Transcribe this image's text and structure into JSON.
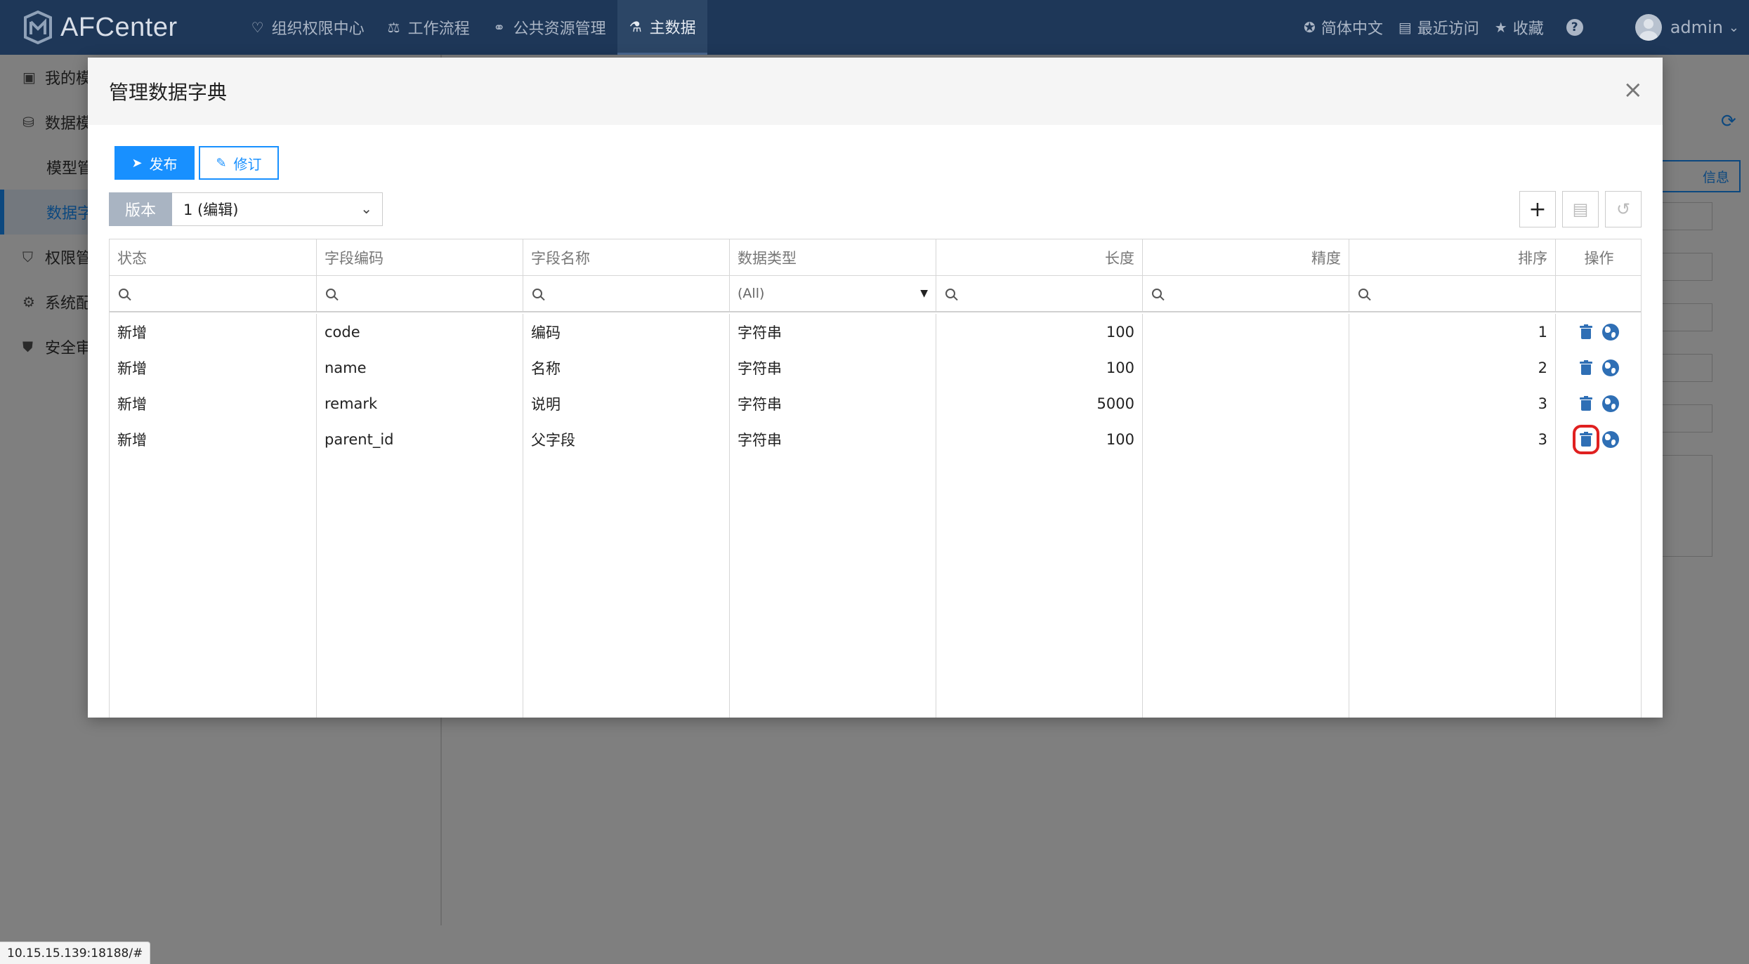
{
  "app": {
    "logo_text": "AFCenter",
    "nav": [
      {
        "label": "组织权限中心",
        "icon": "shield-heart-icon"
      },
      {
        "label": "工作流程",
        "icon": "scale-icon"
      },
      {
        "label": "公共资源管理",
        "icon": "resources-icon"
      },
      {
        "label": "主数据",
        "icon": "master-data-icon",
        "active": true
      }
    ],
    "language": "简体中文",
    "recent": "最近访问",
    "favorites": "收藏",
    "help": "?",
    "user": "admin"
  },
  "sidebar": {
    "items": [
      {
        "label": "我的模",
        "icon": "calendar-icon"
      },
      {
        "label": "数据模",
        "icon": "database-icon"
      },
      {
        "label": "权限管",
        "icon": "permission-shield-icon"
      },
      {
        "label": "系统配",
        "icon": "settings-gear-icon"
      },
      {
        "label": "安全审",
        "icon": "security-audit-icon"
      }
    ],
    "subitems": [
      {
        "label": "模型管"
      },
      {
        "label": "数据字",
        "active": true
      }
    ]
  },
  "background": {
    "button_label": "信息"
  },
  "modal": {
    "title": "管理数据字典",
    "close": "×",
    "publish_label": "发布",
    "revise_label": "修订",
    "version_label": "版本",
    "version_value": "1 (编辑)",
    "add_symbol": "+",
    "columns": [
      "状态",
      "字段编码",
      "字段名称",
      "数据类型",
      "长度",
      "精度",
      "排序",
      "操作"
    ],
    "datatype_filter": "(All)",
    "rows": [
      {
        "status": "新增",
        "code": "code",
        "name": "编码",
        "type": "字符串",
        "length": "100",
        "precision": "",
        "order": "1"
      },
      {
        "status": "新增",
        "code": "name",
        "name": "名称",
        "type": "字符串",
        "length": "100",
        "precision": "",
        "order": "2"
      },
      {
        "status": "新增",
        "code": "remark",
        "name": "说明",
        "type": "字符串",
        "length": "5000",
        "precision": "",
        "order": "3"
      },
      {
        "status": "新增",
        "code": "parent_id",
        "name": "父字段",
        "type": "字符串",
        "length": "100",
        "precision": "",
        "order": "3",
        "highlight": true
      }
    ]
  },
  "statusbar": {
    "url": "10.15.15.139:18188/#"
  },
  "colors": {
    "topnav": "#1e3758",
    "primary": "#1890ff",
    "icon_blue": "#2f6fb5",
    "highlight": "#e02020"
  }
}
